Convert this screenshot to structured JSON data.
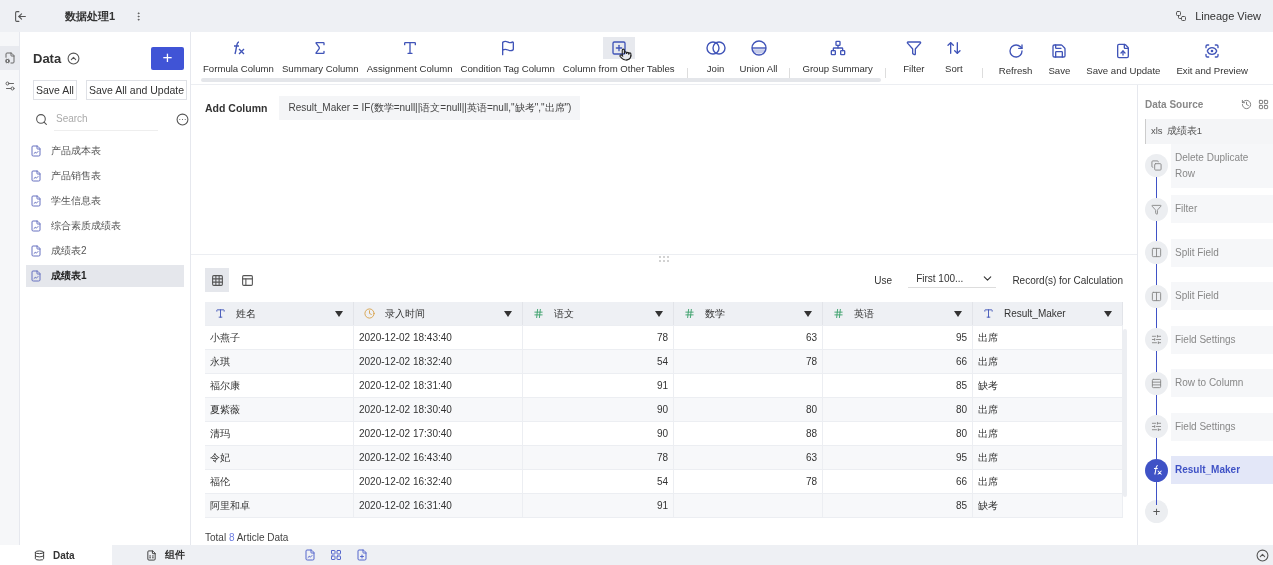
{
  "topbar": {
    "title": "数据处理1",
    "lineage_view": "Lineage View"
  },
  "rail": [
    {
      "selected": true
    },
    {
      "selected": false
    }
  ],
  "sidebar": {
    "title": "Data",
    "add": "+",
    "save_all": "Save All",
    "save_all_update": "Save All and Update",
    "search": {
      "placeholder": "Search"
    },
    "items": [
      {
        "label": "产品成本表",
        "selected": false
      },
      {
        "label": "产品销售表",
        "selected": false
      },
      {
        "label": "学生信息表",
        "selected": false
      },
      {
        "label": "综合素质成绩表",
        "selected": false
      },
      {
        "label": "成绩表2",
        "selected": false
      },
      {
        "label": "成绩表1",
        "selected": true
      }
    ]
  },
  "toolbar": {
    "groups": [
      [
        {
          "label": "Formula Column",
          "kind": "formula",
          "hovered": false
        },
        {
          "label": "Summary Column",
          "kind": "sum",
          "hovered": false
        },
        {
          "label": "Assignment Column",
          "kind": "assign",
          "hovered": false
        },
        {
          "label": "Condition Tag Column",
          "kind": "tag",
          "hovered": false
        },
        {
          "label": "Column from Other Tables",
          "kind": "addcol",
          "hovered": true
        }
      ],
      [
        {
          "label": "Join",
          "kind": "join",
          "hovered": false
        },
        {
          "label": "Union All",
          "kind": "union",
          "hovered": false
        }
      ],
      [
        {
          "label": "Group Summary",
          "kind": "group",
          "hovered": false
        }
      ],
      [
        {
          "label": "Filter",
          "kind": "filter",
          "hovered": false
        },
        {
          "label": "Sort",
          "kind": "sort",
          "hovered": false
        }
      ]
    ],
    "actions": [
      {
        "label": "Refresh",
        "kind": "refresh"
      },
      {
        "label": "Save",
        "kind": "save"
      },
      {
        "label": "Save and Update",
        "kind": "saveupdate"
      },
      {
        "label": "Exit and Preview",
        "kind": "preview"
      }
    ]
  },
  "formula": {
    "label": "Add Column",
    "expression": "Result_Maker = IF(数学=null||语文=null||英语=null,\"缺考\",\"出席\")"
  },
  "grid": {
    "views": [
      {
        "selected": true
      },
      {
        "selected": false
      }
    ],
    "use": "Use",
    "limit": "First 100...",
    "calc": "Record(s) for Calculation",
    "columns": [
      {
        "name": "姓名",
        "kind": "text"
      },
      {
        "name": "录入时间",
        "kind": "date"
      },
      {
        "name": "语文",
        "kind": "number"
      },
      {
        "name": "数学",
        "kind": "number"
      },
      {
        "name": "英语",
        "kind": "number"
      },
      {
        "name": "Result_Maker",
        "kind": "text"
      }
    ],
    "rows": [
      [
        "小燕子",
        "2020-12-02 18:43:40",
        "78",
        "63",
        "95",
        "出席"
      ],
      [
        "永琪",
        "2020-12-02 18:32:40",
        "54",
        "78",
        "66",
        "出席"
      ],
      [
        "福尔康",
        "2020-12-02 18:31:40",
        "91",
        "",
        "85",
        "缺考"
      ],
      [
        "夏紫薇",
        "2020-12-02 18:30:40",
        "90",
        "80",
        "80",
        "出席"
      ],
      [
        "清玛",
        "2020-12-02 17:30:40",
        "90",
        "88",
        "80",
        "出席"
      ],
      [
        "令妃",
        "2020-12-02 16:43:40",
        "78",
        "63",
        "95",
        "出席"
      ],
      [
        "福伦",
        "2020-12-02 16:32:40",
        "54",
        "78",
        "66",
        "出席"
      ],
      [
        "阿里和卓",
        "2020-12-02 16:31:40",
        "91",
        "",
        "85",
        "缺考"
      ]
    ],
    "footer": {
      "prefix": "Total",
      "count": "8",
      "suffix": "Article Data"
    }
  },
  "pipeline": {
    "title": "Data Source",
    "source": {
      "badge": "xls",
      "name": "成绩表1"
    },
    "steps": [
      {
        "label": "Delete Duplicate Row",
        "kind": "dedupe",
        "selected": false
      },
      {
        "label": "Filter",
        "kind": "filter",
        "selected": false
      },
      {
        "label": "Split Field",
        "kind": "split",
        "selected": false
      },
      {
        "label": "Split Field",
        "kind": "split",
        "selected": false
      },
      {
        "label": "Field Settings",
        "kind": "settings",
        "selected": false
      },
      {
        "label": "Row to Column",
        "kind": "pivot",
        "selected": false
      },
      {
        "label": "Field Settings",
        "kind": "settings",
        "selected": false
      },
      {
        "label": "Result_Maker",
        "kind": "formula",
        "selected": true
      }
    ],
    "add": "+"
  },
  "bottom": {
    "tabs": [
      {
        "label": "Data",
        "selected": true
      },
      {
        "label": "组件",
        "selected": false
      }
    ]
  }
}
